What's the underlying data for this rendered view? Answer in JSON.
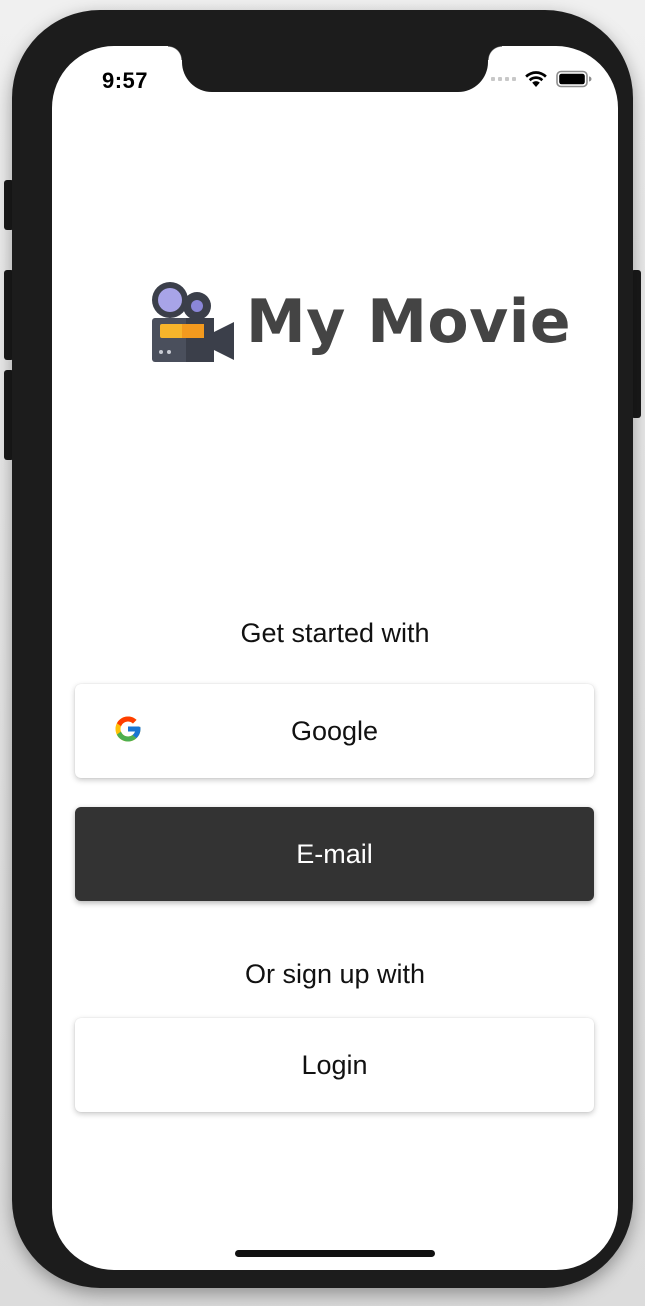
{
  "status_bar": {
    "time": "9:57",
    "icons": [
      "cellular-signal-icon",
      "wifi-icon",
      "battery-icon"
    ]
  },
  "logo": {
    "icon": "movie-camera-icon",
    "text": "My Movie"
  },
  "get_started": {
    "prompt": "Get started with",
    "google_label": "Google",
    "google_icon": "google-icon",
    "email_label": "E-mail"
  },
  "signup": {
    "prompt": "Or sign up with",
    "login_label": "Login"
  },
  "colors": {
    "dark_button": "#333333",
    "logo_text": "#444444",
    "background": "#ffffff"
  }
}
